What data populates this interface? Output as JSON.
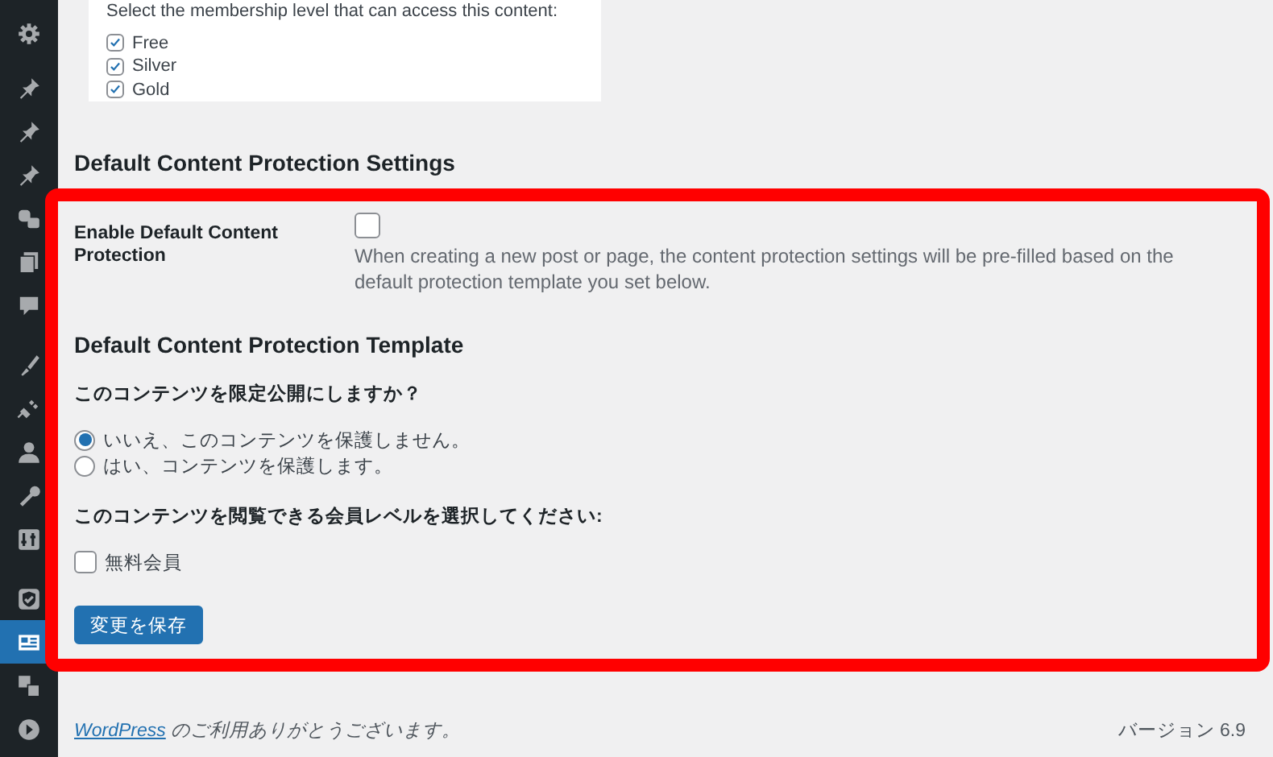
{
  "sidebar": {
    "items": [
      {
        "selected": false
      },
      {
        "selected": false
      },
      {
        "selected": false
      },
      {
        "selected": false
      },
      {
        "selected": false
      },
      {
        "selected": false
      },
      {
        "selected": false
      },
      {
        "selected": false
      },
      {
        "selected": false
      },
      {
        "selected": false
      },
      {
        "selected": false
      },
      {
        "selected": false
      },
      {
        "selected": false
      },
      {
        "selected": true
      },
      {
        "selected": false
      },
      {
        "selected": false
      }
    ]
  },
  "access_box": {
    "prompt": "Select the membership level that can access this content:",
    "levels": [
      {
        "label": "Free",
        "checked": true
      },
      {
        "label": "Silver",
        "checked": true
      },
      {
        "label": "Gold",
        "checked": true
      }
    ]
  },
  "section_title": "Default Content Protection Settings",
  "settings": {
    "enable_label": "Enable Default Content Protection",
    "enable_checked": false,
    "enable_description": "When creating a new post or page, the content protection settings will be pre-filled based on the default protection template you set below."
  },
  "template": {
    "title": "Default Content Protection Template",
    "question": "このコンテンツを限定公開にしますか？",
    "options": [
      {
        "label": "いいえ、このコンテンツを保護しません。",
        "selected": true
      },
      {
        "label": "はい、コンテンツを保護します。",
        "selected": false
      }
    ],
    "levels_prompt": "このコンテンツを閲覧できる会員レベルを選択してください:",
    "levels": [
      {
        "label": "無料会員",
        "checked": false
      }
    ]
  },
  "save_button": "変更を保存",
  "footer": {
    "link": "WordPress",
    "text": "のご利用ありがとうございます。",
    "version": "バージョン 6.9"
  }
}
